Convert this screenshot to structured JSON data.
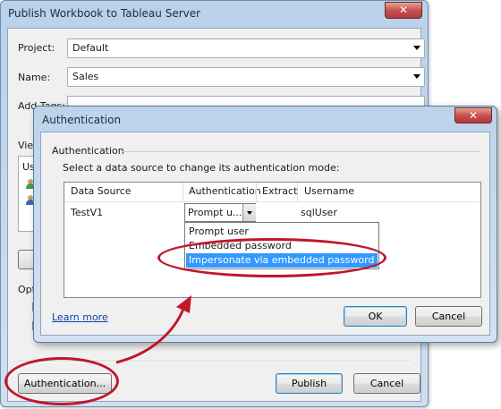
{
  "main_window": {
    "title": "Publish Workbook to Tableau Server",
    "close_glyph": "✕",
    "project": {
      "label": "Project:",
      "value": "Default"
    },
    "name": {
      "label": "Name:",
      "value": "Sales"
    },
    "add_tags": {
      "label": "Add Tags:",
      "value": ""
    },
    "partial_labels": {
      "views": "View",
      "users": "Us",
      "options": "Optio"
    },
    "buttons": {
      "authentication": "Authentication...",
      "publish": "Publish",
      "cancel": "Cancel"
    }
  },
  "auth_dialog": {
    "title": "Authentication",
    "close_glyph": "✕",
    "group_label": "Authentication",
    "instruction": "Select a data source to change its authentication mode:",
    "columns": [
      "Data Source",
      "Authentication",
      "Extract",
      "Username"
    ],
    "row": {
      "data_source": "TestV1",
      "authentication": "Prompt u...",
      "extract": "",
      "username": "sqlUser"
    },
    "options": [
      "Prompt user",
      "Embedded password",
      "Impersonate via embedded password"
    ],
    "selected_option": "Impersonate via embedded password",
    "learn_more": "Learn more",
    "buttons": {
      "ok": "OK",
      "cancel": "Cancel"
    }
  },
  "colors": {
    "highlight": "#3399ff",
    "callout": "#c0172b",
    "title_gradient": "#b9d1ea"
  }
}
